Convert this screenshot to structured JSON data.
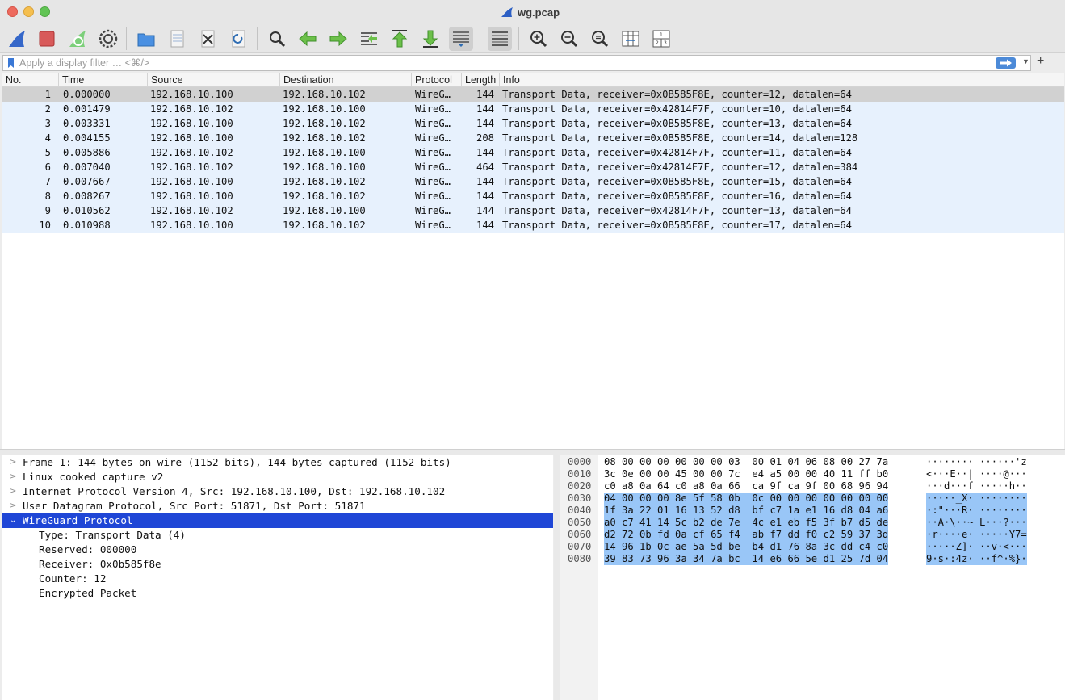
{
  "window": {
    "title": "wg.pcap"
  },
  "toolbar": {
    "icons": [
      "shark-fin-start-icon",
      "stop-capture-icon",
      "restart-capture-icon",
      "capture-options-icon",
      "open-file-icon",
      "save-file-icon",
      "close-file-icon",
      "reload-file-icon",
      "find-packet-icon",
      "go-back-icon",
      "go-forward-icon",
      "go-to-packet-icon",
      "go-first-packet-icon",
      "go-last-packet-icon",
      "autoscroll-icon",
      "colorize-icon",
      "zoom-in-icon",
      "zoom-out-icon",
      "zoom-normal-icon",
      "resize-columns-icon",
      "layout-panes-icon"
    ]
  },
  "filter": {
    "placeholder": "Apply a display filter … <⌘/>",
    "value": ""
  },
  "packet_list": {
    "columns": [
      "No.",
      "Time",
      "Source",
      "Destination",
      "Protocol",
      "Length",
      "Info"
    ],
    "rows": [
      {
        "no": "1",
        "time": "0.000000",
        "src": "192.168.10.100",
        "dst": "192.168.10.102",
        "proto": "WireG…",
        "len": "144",
        "info": "Transport Data, receiver=0x0B585F8E, counter=12, datalen=64"
      },
      {
        "no": "2",
        "time": "0.001479",
        "src": "192.168.10.102",
        "dst": "192.168.10.100",
        "proto": "WireG…",
        "len": "144",
        "info": "Transport Data, receiver=0x42814F7F, counter=10, datalen=64"
      },
      {
        "no": "3",
        "time": "0.003331",
        "src": "192.168.10.100",
        "dst": "192.168.10.102",
        "proto": "WireG…",
        "len": "144",
        "info": "Transport Data, receiver=0x0B585F8E, counter=13, datalen=64"
      },
      {
        "no": "4",
        "time": "0.004155",
        "src": "192.168.10.100",
        "dst": "192.168.10.102",
        "proto": "WireG…",
        "len": "208",
        "info": "Transport Data, receiver=0x0B585F8E, counter=14, datalen=128"
      },
      {
        "no": "5",
        "time": "0.005886",
        "src": "192.168.10.102",
        "dst": "192.168.10.100",
        "proto": "WireG…",
        "len": "144",
        "info": "Transport Data, receiver=0x42814F7F, counter=11, datalen=64"
      },
      {
        "no": "6",
        "time": "0.007040",
        "src": "192.168.10.102",
        "dst": "192.168.10.100",
        "proto": "WireG…",
        "len": "464",
        "info": "Transport Data, receiver=0x42814F7F, counter=12, datalen=384"
      },
      {
        "no": "7",
        "time": "0.007667",
        "src": "192.168.10.100",
        "dst": "192.168.10.102",
        "proto": "WireG…",
        "len": "144",
        "info": "Transport Data, receiver=0x0B585F8E, counter=15, datalen=64"
      },
      {
        "no": "8",
        "time": "0.008267",
        "src": "192.168.10.100",
        "dst": "192.168.10.102",
        "proto": "WireG…",
        "len": "144",
        "info": "Transport Data, receiver=0x0B585F8E, counter=16, datalen=64"
      },
      {
        "no": "9",
        "time": "0.010562",
        "src": "192.168.10.102",
        "dst": "192.168.10.100",
        "proto": "WireG…",
        "len": "144",
        "info": "Transport Data, receiver=0x42814F7F, counter=13, datalen=64"
      },
      {
        "no": "10",
        "time": "0.010988",
        "src": "192.168.10.100",
        "dst": "192.168.10.102",
        "proto": "WireG…",
        "len": "144",
        "info": "Transport Data, receiver=0x0B585F8E, counter=17, datalen=64"
      }
    ]
  },
  "details": {
    "items": [
      {
        "label": "Frame 1: 144 bytes on wire (1152 bits), 144 bytes captured (1152 bits)"
      },
      {
        "label": "Linux cooked capture v2"
      },
      {
        "label": "Internet Protocol Version 4, Src: 192.168.10.100, Dst: 192.168.10.102"
      },
      {
        "label": "User Datagram Protocol, Src Port: 51871, Dst Port: 51871"
      },
      {
        "label": "WireGuard Protocol"
      }
    ],
    "children": [
      {
        "label": "Type: Transport Data (4)"
      },
      {
        "label": "Reserved: 000000"
      },
      {
        "label": "Receiver: 0x0b585f8e"
      },
      {
        "label": "Counter: 12"
      },
      {
        "label": "Encrypted Packet"
      }
    ]
  },
  "bytes": {
    "rows": [
      {
        "off": "0000",
        "hex": "08 00 00 00 00 00 00 03  00 01 04 06 08 00 27 7a",
        "ascii": "········ ······'z"
      },
      {
        "off": "0010",
        "hex": "3c 0e 00 00 45 00 00 7c  e4 a5 00 00 40 11 ff b0",
        "ascii": "<···E··| ····@···"
      },
      {
        "off": "0020",
        "hex": "c0 a8 0a 64 c0 a8 0a 66  ca 9f ca 9f 00 68 96 94",
        "ascii": "···d···f ·····h··"
      },
      {
        "off": "0030",
        "hex": "04 00 00 00 8e 5f 58 0b  0c 00 00 00 00 00 00 00",
        "ascii": "·····_X· ········"
      },
      {
        "off": "0040",
        "hex": "1f 3a 22 01 16 13 52 d8  bf c7 1a e1 16 d8 04 a6",
        "ascii": "·:\"···R· ········"
      },
      {
        "off": "0050",
        "hex": "a0 c7 41 14 5c b2 de 7e  4c e1 eb f5 3f b7 d5 de",
        "ascii": "··A·\\··~ L···?···"
      },
      {
        "off": "0060",
        "hex": "d2 72 0b fd 0a cf 65 f4  ab f7 dd f0 c2 59 37 3d",
        "ascii": "·r····e· ·····Y7="
      },
      {
        "off": "0070",
        "hex": "14 96 1b 0c ae 5a 5d be  b4 d1 76 8a 3c dd c4 c0",
        "ascii": "·····Z]· ··v·<···"
      },
      {
        "off": "0080",
        "hex": "39 83 73 96 3a 34 7a bc  14 e6 66 5e d1 25 7d 04",
        "ascii": "9·s·:4z· ··f^·%}·"
      }
    ]
  },
  "colors": {
    "row_bg": "#e7f1fd",
    "row_selected": "#d1d1d1",
    "tree_selected": "#1f46d6",
    "byte_highlight": "#99c6f7"
  }
}
